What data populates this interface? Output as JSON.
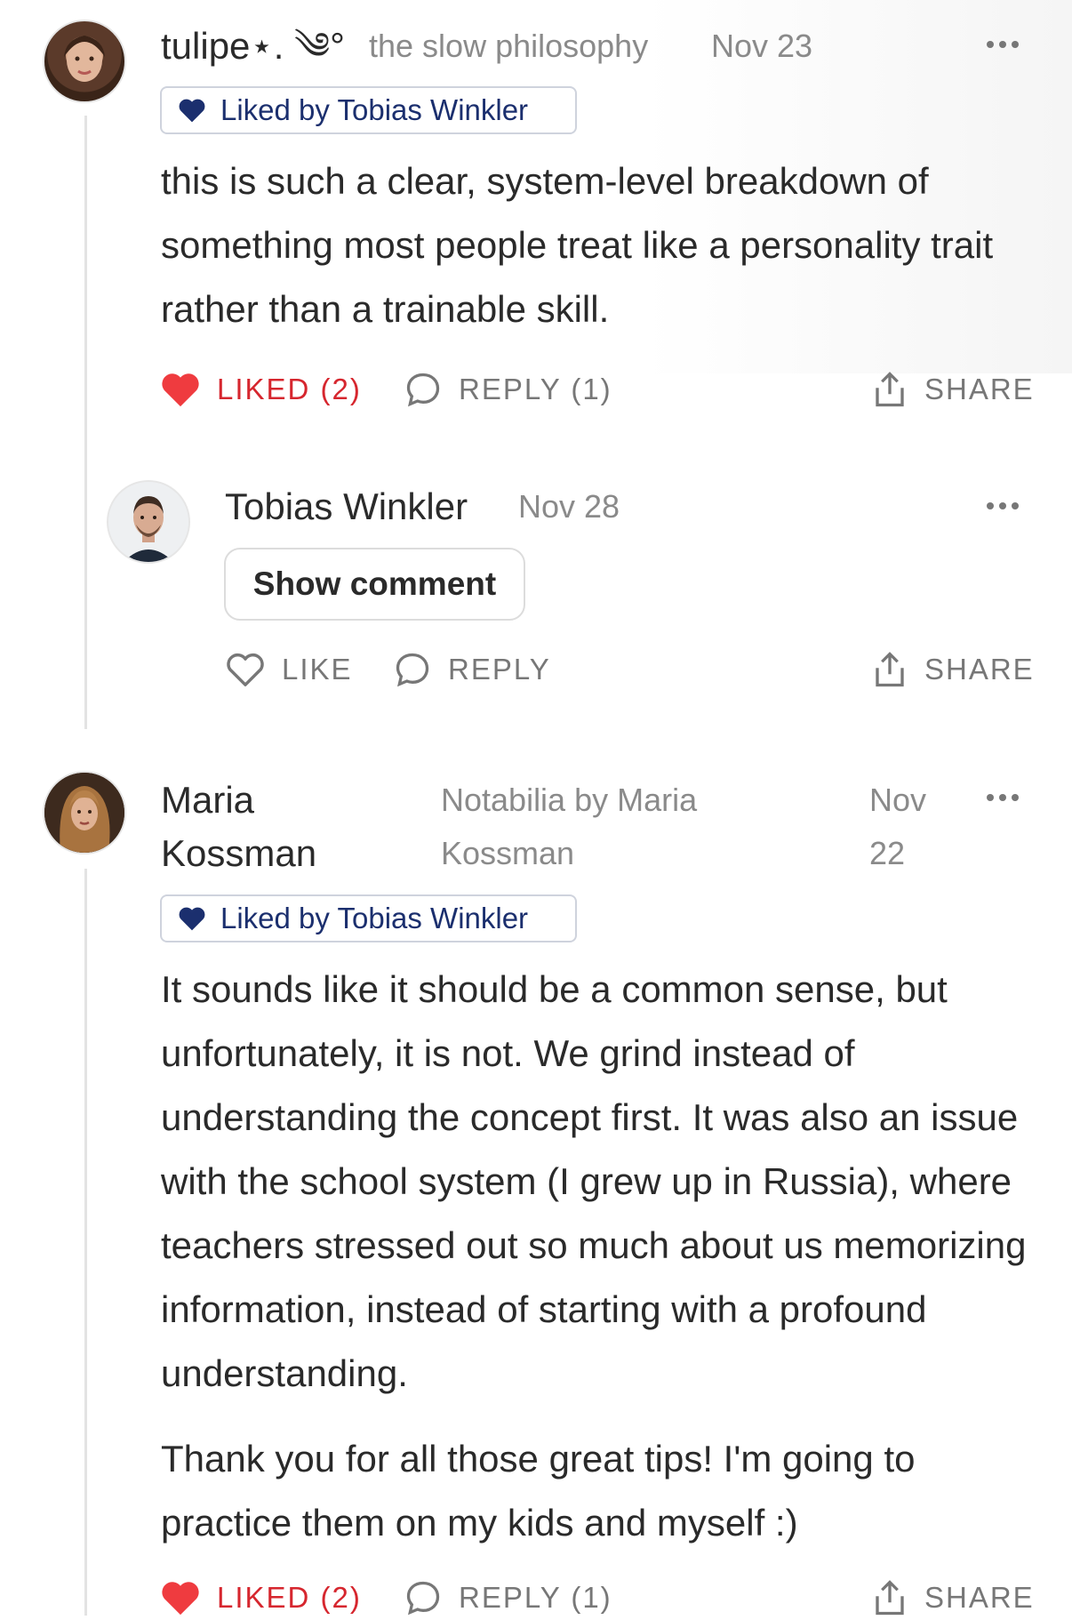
{
  "comments": [
    {
      "author": "tulipe⋆. ༄°",
      "publication": "the slow philosophy",
      "date": "Nov 23",
      "liked_by": "Liked by Tobias Winkler",
      "body": "this is such a clear, system-level breakdown of something most people treat like a personality trait rather than a trainable skill.",
      "like_label": "LIKED (2)",
      "reply_label": "REPLY (1)",
      "share_label": "SHARE"
    },
    {
      "author": "Tobias Winkler",
      "date": "Nov 28",
      "show_comment_label": "Show comment",
      "like_label": "LIKE",
      "reply_label": "REPLY",
      "share_label": "SHARE"
    },
    {
      "author_line1": "Maria",
      "author_line2": "Kossman",
      "publication_line1": "Notabilia by Maria",
      "publication_line2": "Kossman",
      "date_line1": "Nov",
      "date_line2": "22",
      "liked_by": "Liked by Tobias Winkler",
      "paragraph1": "It sounds like it should be a common sense, but unfortunately, it is not. We grind instead of understanding the concept first. It was also an issue with the school system (I grew up in Russia), where teachers stressed out so much about us memorizing information, instead of starting with a profound understanding.",
      "paragraph2": "Thank you for all those great tips! I'm going to practice them on my kids and myself :)",
      "like_label": "LIKED (2)",
      "reply_label": "REPLY (1)",
      "share_label": "SHARE"
    }
  ],
  "icons": {
    "more": "more-horizontal-icon",
    "heart_filled": "heart-filled-icon",
    "heart_outline": "heart-outline-icon",
    "reply": "speech-bubble-icon",
    "share": "share-upload-icon"
  },
  "colors": {
    "liked_red": "#d6262e",
    "badge_navy": "#1b2f6e",
    "muted_gray": "#777777"
  }
}
